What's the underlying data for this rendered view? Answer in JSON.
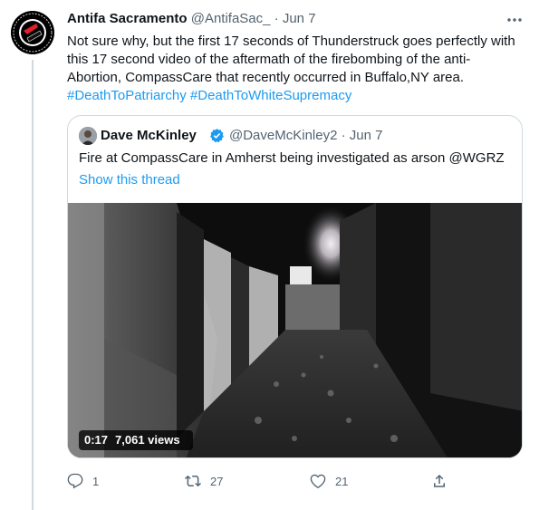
{
  "tweet": {
    "author_name": "Antifa Sacramento",
    "author_handle": "@AntifaSac_",
    "separator": "·",
    "date": "Jun 7",
    "text_line1": "Not sure why, but the first 17 seconds of Thunderstruck goes perfectly with",
    "text_line2": "this 17 second video of the aftermath of the firebombing of the anti-",
    "text_line3": "Abortion, CompassCare that recently occurred in Buffalo,NY area.",
    "hashtag1": "#DeathToPatriarchy",
    "hashtag2": "#DeathToWhiteSupremacy",
    "more_icon": "ellipsis-icon"
  },
  "quoted_tweet": {
    "author_name": "Dave McKinley",
    "author_handle": "@DaveMcKinley2",
    "separator": "·",
    "date": "Jun 7",
    "text": "Fire at CompassCare in Amherst being investigated as arson @WGRZ",
    "show_thread": "Show this thread",
    "video": {
      "duration": "0:17",
      "views": "7,061 views"
    }
  },
  "actions": {
    "reply_count": "1",
    "retweet_count": "27",
    "like_count": "21"
  },
  "colors": {
    "accent": "#1d9bf0",
    "muted": "#536471",
    "text": "#0f1419",
    "border": "#cfd9de",
    "logo_red": "#e0202a"
  }
}
